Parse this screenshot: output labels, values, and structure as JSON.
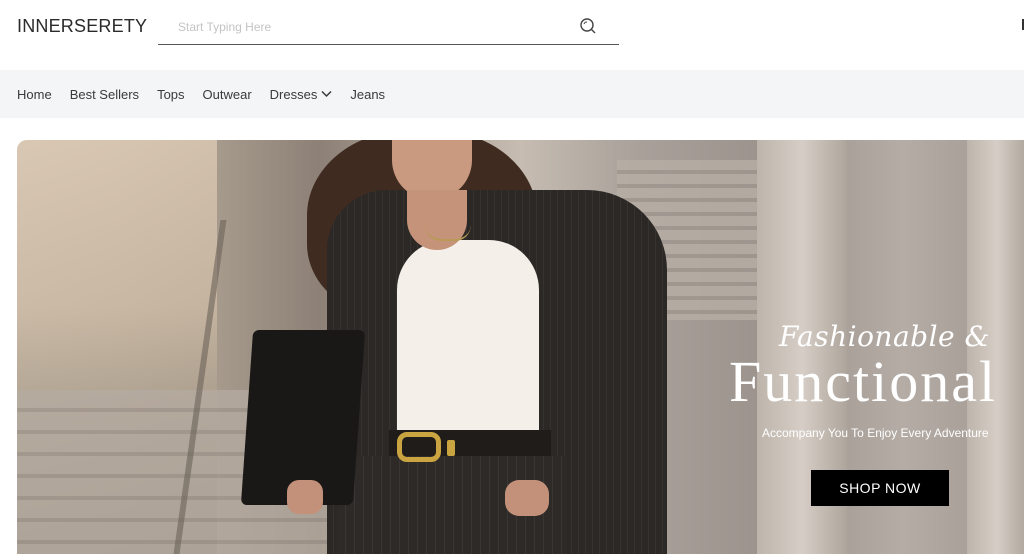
{
  "header": {
    "logo": "INNERSERETY",
    "search_placeholder": "Start Typing Here",
    "search_icon": "search-icon"
  },
  "nav": {
    "items": [
      {
        "label": "Home"
      },
      {
        "label": "Best Sellers"
      },
      {
        "label": "Tops"
      },
      {
        "label": "Outwear"
      },
      {
        "label": "Dresses",
        "icon": "chevron-down-icon"
      },
      {
        "label": "Jeans"
      }
    ]
  },
  "hero": {
    "tagline": "Fashionable &",
    "headline": "Functional",
    "subline": "Accompany You To Enjoy Every Adventure",
    "cta_label": "SHOP NOW"
  },
  "colors": {
    "nav_bg": "#f3f5f6",
    "cta_bg": "#000000",
    "text": "#333333"
  }
}
